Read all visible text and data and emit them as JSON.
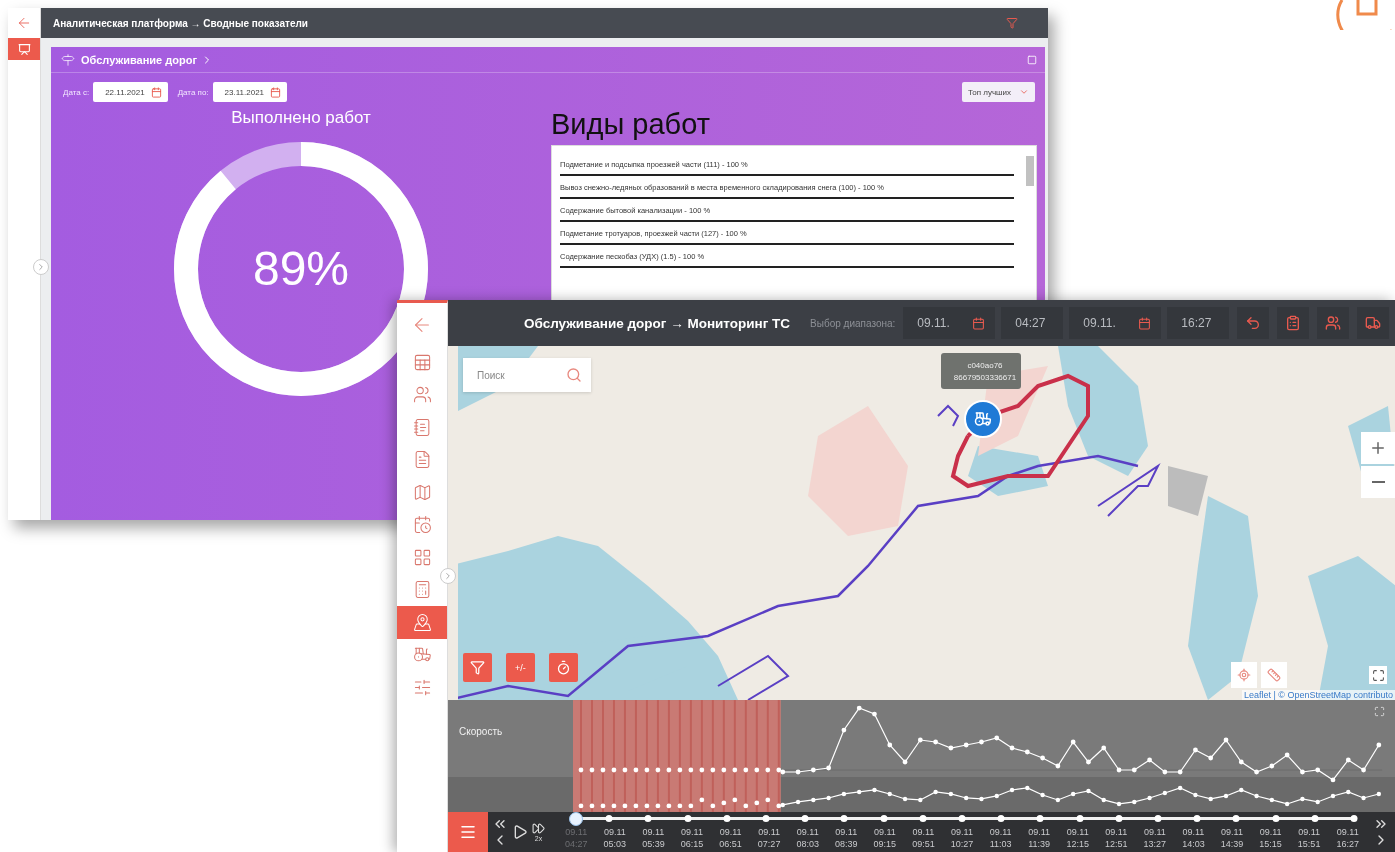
{
  "analytics_window": {
    "title": "Аналитическая платформа → Сводные показатели",
    "sidebar_items": [
      {
        "kind": "dashboard",
        "selected": true
      }
    ],
    "card": {
      "title": "Обслуживание дорог",
      "date_from": {
        "label": "Дата с:",
        "value": "22.11.2021"
      },
      "date_to": {
        "label": "Дата по:",
        "value": "23.11.2021"
      },
      "filter": {
        "value": "Топ лучших"
      },
      "gauge": {
        "title": "Выполнено работ",
        "reading": "89%",
        "level": 0.89
      },
      "work_types": {
        "title": "Виды работ",
        "items": [
          "Подметание и подсыпка проезжей части (111) - 100 %",
          "Вывоз снежно-ледяных образований в места временного складирования снега (100) - 100 %",
          "Содержание бытовой канализации - 100 %",
          "Подметание тротуаров, проезжей части (127) - 100 %",
          "Содержание пескобаз (УДХ) (1.5) - 100 %"
        ]
      }
    }
  },
  "monitoring_window": {
    "title": "Обслуживание дорог → Мониторинг ТС",
    "range_label": "Выбор диапазона:",
    "range": [
      {
        "date": "09.11.",
        "time": "04:27"
      },
      {
        "date": "09.11.",
        "time": "16:27"
      }
    ],
    "sidebar_items": [
      {
        "kind": "table-user",
        "selected": false
      },
      {
        "kind": "users",
        "selected": false
      },
      {
        "kind": "notebook",
        "selected": false
      },
      {
        "kind": "document",
        "selected": false
      },
      {
        "kind": "map",
        "selected": false
      },
      {
        "kind": "calendar",
        "selected": false
      },
      {
        "kind": "grid-add",
        "selected": false
      },
      {
        "kind": "calculator",
        "selected": false
      },
      {
        "kind": "map-pin",
        "selected": true
      },
      {
        "kind": "vehicle",
        "selected": false
      },
      {
        "kind": "sliders",
        "selected": false
      }
    ],
    "map": {
      "search_placeholder": "Поиск",
      "tooltip": [
        "c040ao76",
        "86679503336671"
      ],
      "tool_buttons": [
        {
          "kind": "filter"
        },
        {
          "kind": "text",
          "label": "+/-"
        },
        {
          "kind": "timer"
        }
      ],
      "attribution": "Leaflet | © OpenStreetMap contributo"
    },
    "chart": {
      "label": "Скорость"
    },
    "player": {
      "speed": "2x",
      "level": 0,
      "ticks": [
        {
          "date": "09.11",
          "time": "04:27",
          "muted": true
        },
        {
          "date": "09.11",
          "time": "05:03",
          "muted": false
        },
        {
          "date": "09.11",
          "time": "05:39",
          "muted": false
        },
        {
          "date": "09.11",
          "time": "06:15",
          "muted": false
        },
        {
          "date": "09.11",
          "time": "06:51",
          "muted": false
        },
        {
          "date": "09.11",
          "time": "07:27",
          "muted": false
        },
        {
          "date": "09.11",
          "time": "08:03",
          "muted": false
        },
        {
          "date": "09.11",
          "time": "08:39",
          "muted": false
        },
        {
          "date": "09.11",
          "time": "09:15",
          "muted": false
        },
        {
          "date": "09.11",
          "time": "09:51",
          "muted": false
        },
        {
          "date": "09.11",
          "time": "10:27",
          "muted": false
        },
        {
          "date": "09.11",
          "time": "11:03",
          "muted": false
        },
        {
          "date": "09.11",
          "time": "11:39",
          "muted": false
        },
        {
          "date": "09.11",
          "time": "12:15",
          "muted": false
        },
        {
          "date": "09.11",
          "time": "12:51",
          "muted": false
        },
        {
          "date": "09.11",
          "time": "13:27",
          "muted": false
        },
        {
          "date": "09.11",
          "time": "14:03",
          "muted": false
        },
        {
          "date": "09.11",
          "time": "14:39",
          "muted": false
        },
        {
          "date": "09.11",
          "time": "15:15",
          "muted": false
        },
        {
          "date": "09.11",
          "time": "15:51",
          "muted": false
        },
        {
          "date": "09.11",
          "time": "16:27",
          "muted": false
        }
      ]
    }
  }
}
